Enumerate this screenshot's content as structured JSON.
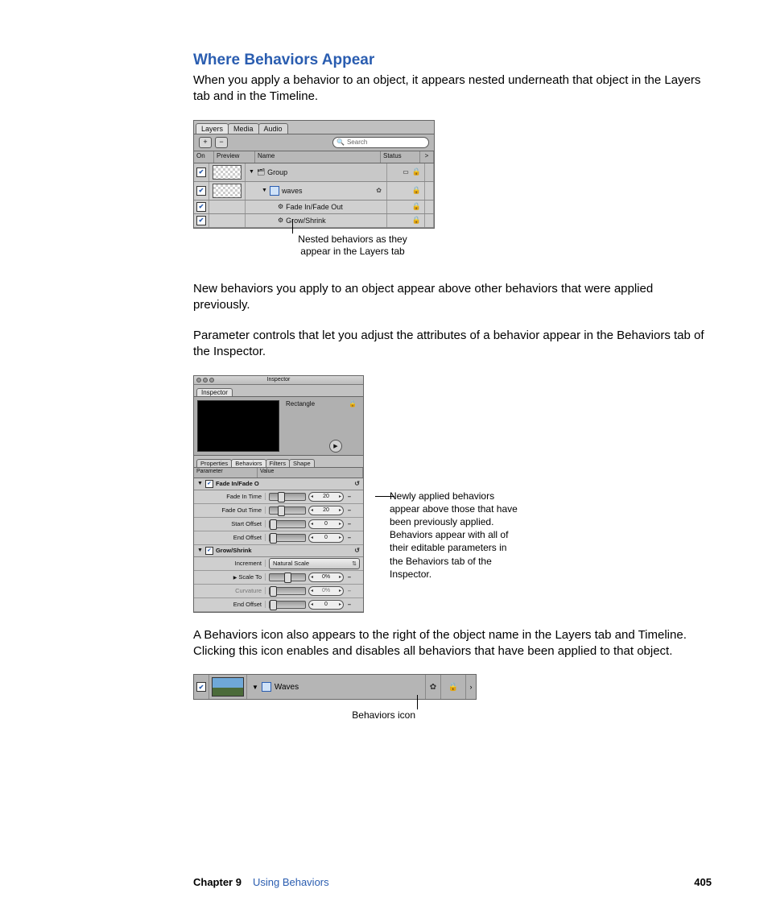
{
  "heading": "Where Behaviors Appear",
  "para1": "When you apply a behavior to an object, it appears nested underneath that object in the Layers tab and in the Timeline.",
  "fig1": {
    "tabs": [
      "Layers",
      "Media",
      "Audio"
    ],
    "search_placeholder": "Search",
    "cols": {
      "on": "On",
      "preview": "Preview",
      "name": "Name",
      "status": "Status",
      "gt": ">"
    },
    "rows": {
      "group": "Group",
      "waves": "waves",
      "fade": "Fade In/Fade Out",
      "grow": "Grow/Shrink"
    },
    "callout": "Nested behaviors as they appear in the Layers tab"
  },
  "para2": "New behaviors you apply to an object appear above other behaviors that were applied previously.",
  "para3": "Parameter controls that let you adjust the attributes of a behavior appear in the Behaviors tab of the Inspector.",
  "fig2": {
    "window_title": "Inspector",
    "tab_inspector": "Inspector",
    "object_name": "Rectangle",
    "tabs2": [
      "Properties",
      "Behaviors",
      "Filters",
      "Shape"
    ],
    "head_param": "Parameter",
    "head_value": "Value",
    "group_fade": "Fade In/Fade O",
    "group_grow": "Grow/Shrink",
    "params": {
      "fade_in": "Fade In Time",
      "fade_out": "Fade Out Time",
      "start_off": "Start Offset",
      "end_off": "End Offset",
      "increment": "Increment",
      "scale_to": "Scale To",
      "curvature": "Curvature",
      "end_off2": "End Offset"
    },
    "vals": {
      "v20a": "20",
      "v20b": "20",
      "v0a": "0",
      "v0b": "0",
      "nat": "Natural Scale",
      "pct0a": "0%",
      "pct0b": "0%",
      "v0c": "0"
    },
    "arrow": "▶",
    "callout": "Newly applied behaviors appear above those that have been previously applied. Behaviors appear with all of their editable parameters in the Behaviors tab of the Inspector."
  },
  "para4": "A Behaviors icon also appears to the right of the object name in the Layers tab and Timeline. Clicking this icon enables and disables all behaviors that have been applied to that object.",
  "fig3": {
    "name": "Waves",
    "callout": "Behaviors icon"
  },
  "footer": {
    "chapter": "Chapter 9",
    "title": "Using Behaviors",
    "page": "405"
  }
}
